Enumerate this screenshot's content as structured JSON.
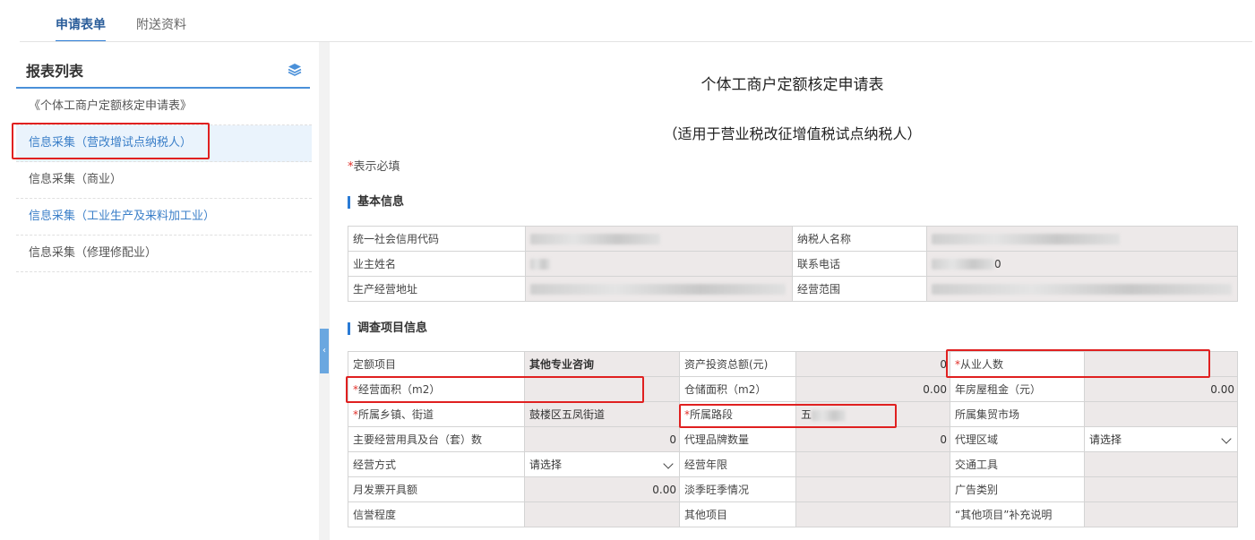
{
  "tabs": [
    {
      "label": "申请表单"
    },
    {
      "label": "附送资料"
    }
  ],
  "sidebar": {
    "title": "报表列表",
    "items": [
      {
        "label": "《个体工商户定额核定申请表》"
      },
      {
        "label": "信息采集（营改增试点纳税人）"
      },
      {
        "label": "信息采集（商业）"
      },
      {
        "label": "信息采集（工业生产及来料加工业）"
      },
      {
        "label": "信息采集（修理修配业）"
      }
    ]
  },
  "form": {
    "title": "个体工商户定额核定申请表",
    "subtitle": "（适用于营业税改征增值税试点纳税人）",
    "required_star": "*",
    "required_note": "表示必填",
    "basic_section": "基本信息",
    "survey_section": "调查项目信息",
    "basic": {
      "credit_code_label": "统一社会信用代码",
      "taxpayer_name_label": "纳税人名称",
      "owner_name_label": "业主姓名",
      "phone_label": "联系电话",
      "phone_suffix": "0",
      "address_label": "生产经营地址",
      "scope_label": "经营范围"
    },
    "survey": {
      "quota_item_label": "定额项目",
      "quota_item_value": "其他专业咨询",
      "asset_label": "资产投资总额(元)",
      "asset_value": "0",
      "employees_label": "从业人数",
      "area_label": "经营面积（m2）",
      "storage_label": "仓储面积（m2）",
      "storage_value": "0.00",
      "rent_label": "年房屋租金（元）",
      "rent_value": "0.00",
      "town_label": "所属乡镇、街道",
      "town_value": "鼓楼区五凤街道",
      "road_label": "所属路段",
      "road_value_prefix": "五",
      "market_label": "所属集贸市场",
      "tools_label": "主要经营用具及台（套）数",
      "tools_value": "0",
      "brands_label": "代理品牌数量",
      "brands_value": "0",
      "agent_area_label": "代理区域",
      "agent_area_value": "请选择",
      "mode_label": "经营方式",
      "mode_value": "请选择",
      "years_label": "经营年限",
      "transport_label": "交通工具",
      "invoice_label": "月发票开具额",
      "invoice_value": "0.00",
      "season_label": "淡季旺季情况",
      "ad_label": "广告类别",
      "credit_label": "信誉程度",
      "other_label": "其他项目",
      "other_note_label": "“其他项目”补充说明"
    }
  },
  "colors": {
    "accent": "#2a7bd5",
    "required": "#e0302a",
    "highlight_box": "#e02020",
    "readonly_cell": "#ede9e9"
  },
  "icons": {
    "sidebar_header": "layers-icon",
    "collapse": "chevron-left-icon",
    "select": "chevron-down-icon"
  }
}
